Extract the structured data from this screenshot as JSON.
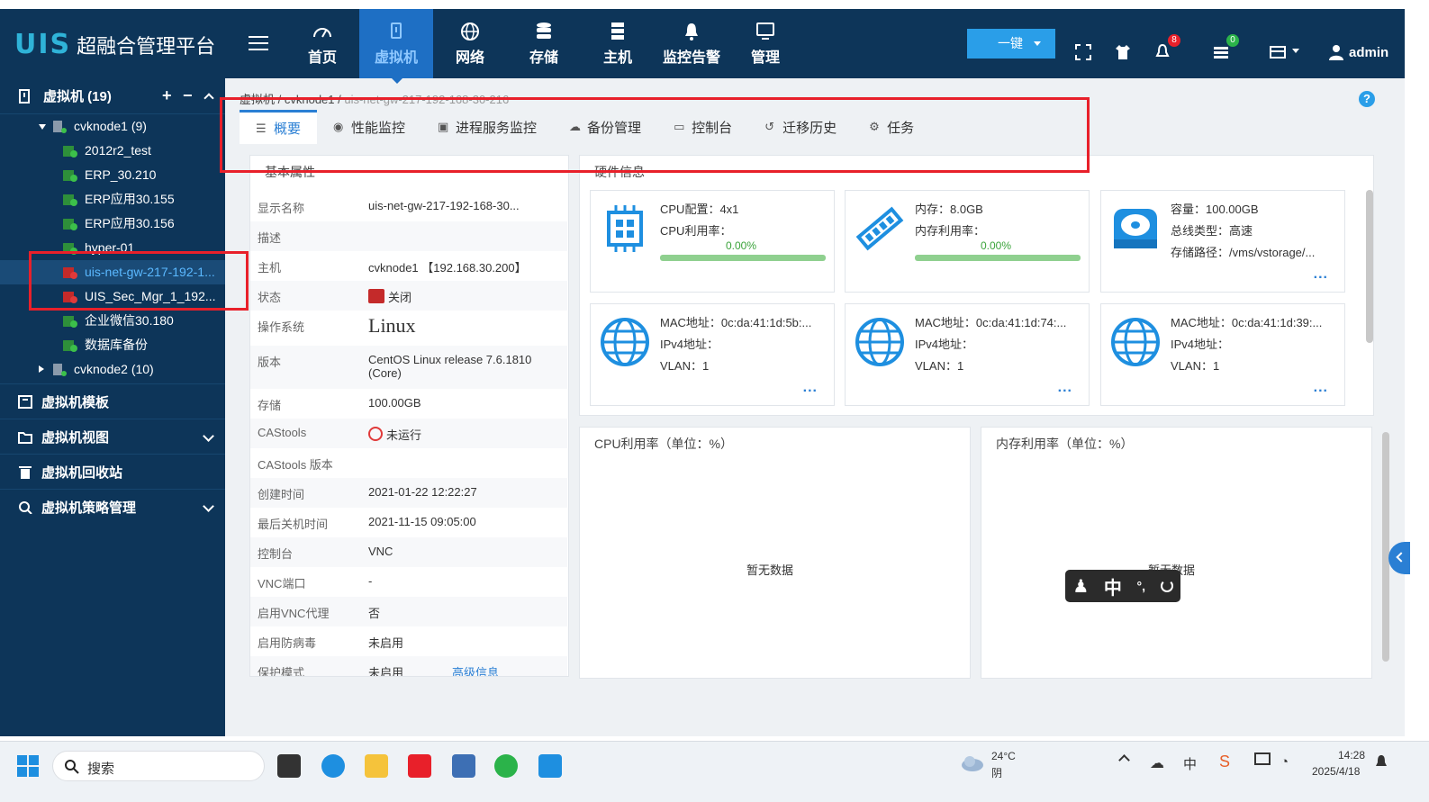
{
  "app": {
    "logo_mark": "UIS",
    "title": "超融合管理平台"
  },
  "nav": [
    {
      "id": "home",
      "label": "首页",
      "icon": "dashboard-icon"
    },
    {
      "id": "vm",
      "label": "虚拟机",
      "icon": "vm-icon",
      "active": true
    },
    {
      "id": "network",
      "label": "网络",
      "icon": "globe-icon"
    },
    {
      "id": "storage",
      "label": "存储",
      "icon": "database-icon"
    },
    {
      "id": "host",
      "label": "主机",
      "icon": "server-icon"
    },
    {
      "id": "alarm",
      "label": "监控告警",
      "icon": "bell-icon"
    },
    {
      "id": "manage",
      "label": "管理",
      "icon": "monitor-icon"
    }
  ],
  "toolbar": {
    "onekey_label": "一键",
    "alerts_badge": "8",
    "tasks_badge": "0",
    "user": "admin"
  },
  "sidebar": {
    "header": "虚拟机 (19)",
    "nodes": [
      {
        "label": "cvknode1 (9)",
        "expanded": true
      },
      {
        "label": "cvknode2 (10)",
        "expanded": false
      }
    ],
    "vms": [
      {
        "label": "2012r2_test",
        "state": "running"
      },
      {
        "label": "ERP_30.210",
        "state": "running"
      },
      {
        "label": "ERP应用30.155",
        "state": "running"
      },
      {
        "label": "ERP应用30.156",
        "state": "running"
      },
      {
        "label": "hyper-01",
        "state": "running"
      },
      {
        "label": "uis-net-gw-217-192-1...",
        "state": "stopped",
        "selected": true
      },
      {
        "label": "UIS_Sec_Mgr_1_192...",
        "state": "stopped"
      },
      {
        "label": "企业微信30.180",
        "state": "running"
      },
      {
        "label": "数据库备份",
        "state": "running"
      }
    ],
    "sections": [
      {
        "label": "虚拟机模板",
        "icon": "template-icon",
        "chevron": false
      },
      {
        "label": "虚拟机视图",
        "icon": "folder-view-icon",
        "chevron": true
      },
      {
        "label": "虚拟机回收站",
        "icon": "trash-icon",
        "chevron": false
      },
      {
        "label": "虚拟机策略管理",
        "icon": "policy-icon",
        "chevron": true
      }
    ]
  },
  "breadcrumb": {
    "root": "虚拟机",
    "node": "cvknode1",
    "vm": "uis-net-gw-217-192-168-30-216"
  },
  "tabs": [
    {
      "label": "概要",
      "icon": "list-icon",
      "active": true
    },
    {
      "label": "性能监控",
      "icon": "gauge-icon"
    },
    {
      "label": "进程服务监控",
      "icon": "process-monitor-icon"
    },
    {
      "label": "备份管理",
      "icon": "cloud-backup-icon"
    },
    {
      "label": "控制台",
      "icon": "console-icon"
    },
    {
      "label": "迁移历史",
      "icon": "history-icon"
    },
    {
      "label": "任务",
      "icon": "task-gear-icon"
    }
  ],
  "basic": {
    "title": "基本属性",
    "rows": [
      {
        "k": "显示名称",
        "v": "uis-net-gw-217-192-168-30..."
      },
      {
        "k": "描述",
        "v": ""
      },
      {
        "k": "主机",
        "v": "cvknode1 【192.168.30.200】"
      },
      {
        "k": "状态",
        "v": "关闭"
      },
      {
        "k": "操作系统",
        "v": "Linux"
      },
      {
        "k": "版本",
        "v": "CentOS Linux release 7.6.1810 (Core)"
      },
      {
        "k": "存储",
        "v": "100.00GB"
      },
      {
        "k": "CAStools",
        "v": "未运行"
      },
      {
        "k": "CAStools 版本",
        "v": ""
      },
      {
        "k": "创建时间",
        "v": "2021-01-22 12:22:27"
      },
      {
        "k": "最后关机时间",
        "v": "2021-11-15 09:05:00"
      },
      {
        "k": "控制台",
        "v": "VNC"
      },
      {
        "k": "VNC端口",
        "v": "-"
      },
      {
        "k": "启用VNC代理",
        "v": "否"
      },
      {
        "k": "启用防病毒",
        "v": "未启用"
      },
      {
        "k": "保护模式",
        "v": "未启用"
      }
    ],
    "advanced_link": "高级信息"
  },
  "hardware": {
    "title": "硬件信息",
    "cpu": {
      "config": "CPU配置：4x1",
      "usage_label": "CPU利用率：",
      "usage": "0.00%"
    },
    "mem": {
      "size": "内存：8.0GB",
      "usage_label": "内存利用率：",
      "usage": "0.00%"
    },
    "disk": {
      "capacity": "容量：100.00GB",
      "bus": "总线类型：高速",
      "path": "存储路径：/vms/vstorage/..."
    },
    "nics": [
      {
        "mac": "MAC地址：0c:da:41:1d:5b:...",
        "ipv4": "IPv4地址：",
        "vlan": "VLAN：1"
      },
      {
        "mac": "MAC地址：0c:da:41:1d:74:...",
        "ipv4": "IPv4地址：",
        "vlan": "VLAN：1"
      },
      {
        "mac": "MAC地址：0c:da:41:1d:39:...",
        "ipv4": "IPv4地址：",
        "vlan": "VLAN：1"
      }
    ],
    "more": "..."
  },
  "charts": {
    "cpu_title": "CPU利用率（单位：%）",
    "mem_title": "内存利用率（单位：%）",
    "no_data": "暂无数据"
  },
  "ime": {
    "mode": "中"
  },
  "taskbar": {
    "search_placeholder": "搜索",
    "weather_temp": "24°C",
    "weather_desc": "阴",
    "lang": "中",
    "time": "14:28",
    "date": "2025/4/18"
  },
  "colors": {
    "nav_bg": "#0d3559",
    "accent": "#2a7fd4",
    "annotation_red": "#e8202a"
  }
}
